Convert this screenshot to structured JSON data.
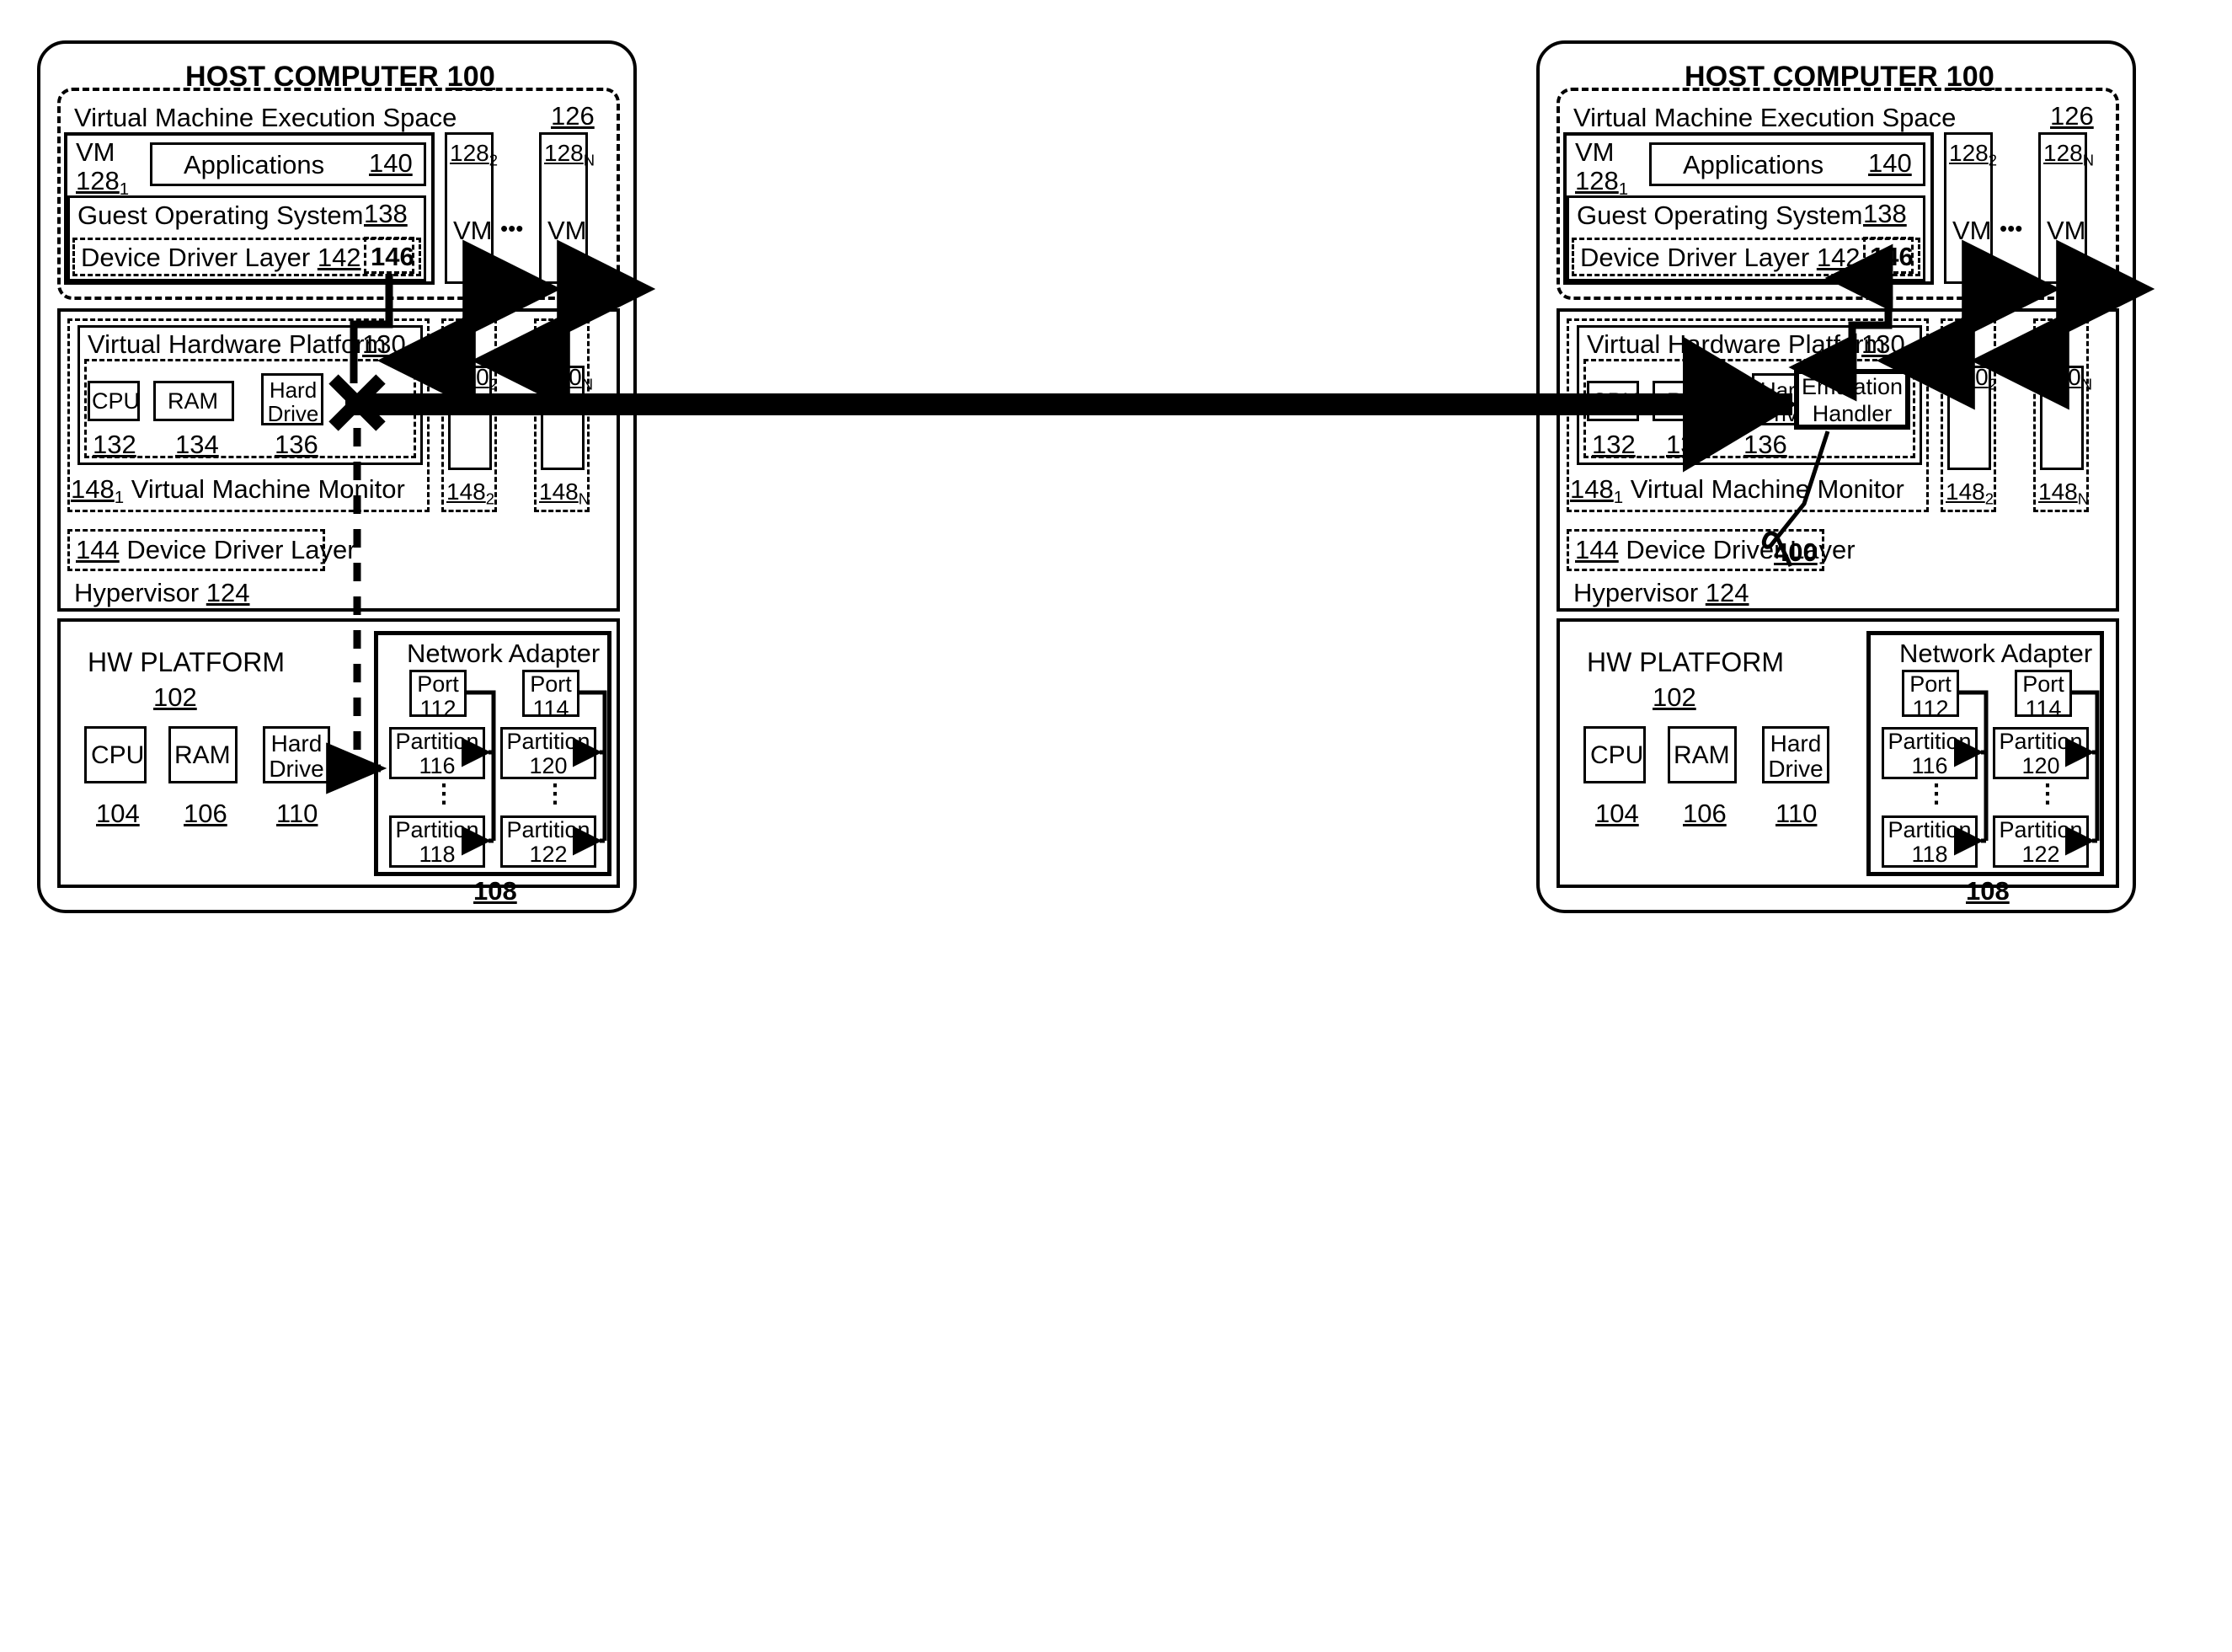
{
  "figure": {
    "panels": [
      {
        "id": "left",
        "host_title": "HOST COMPUTER",
        "host_ref": "100",
        "vmx": {
          "title": "Virtual Machine Execution Space",
          "ref": "126",
          "vm1": {
            "name": "VM",
            "ref_base": "128",
            "ref_sub": "1",
            "applications": "Applications",
            "applications_ref": "140",
            "guest_os": "Guest Operating System",
            "guest_os_ref": "138",
            "ddl": "Device Driver Layer",
            "ddl_ref": "142",
            "box146": "146"
          },
          "vm2": {
            "ref_base": "128",
            "ref_sub": "2",
            "name": "VM"
          },
          "vmn": {
            "ref_base": "128",
            "ref_sub": "N",
            "name": "VM"
          },
          "ellipsis": "•••"
        },
        "hypervisor": {
          "vhp_title": "Virtual Hardware Platform",
          "vhp_ref_base": "130",
          "vhp_ref_sub": "1",
          "cpu": "CPU",
          "cpu_ref": "132",
          "ram": "RAM",
          "ram_ref": "134",
          "hdd": "Hard Drive",
          "hdd_ref": "136",
          "vmm_ref_base": "148",
          "vmm_ref_sub": "1",
          "vmm_title": "Virtual Machine Monitor",
          "vmm2_ref_base": "148",
          "vmm2_ref_sub": "2",
          "vmmn_ref_base": "148",
          "vmmn_ref_sub": "N",
          "vhp2_ref_base": "130",
          "vhp2_ref_sub": "2",
          "vhpn_ref_base": "130",
          "vhpn_ref_sub": "N",
          "ddl144_ref": "144",
          "ddl144_title": "Device Driver Layer",
          "hyp_title": "Hypervisor",
          "hyp_ref": "124",
          "emulation_handler": null,
          "blocked_marker": "X"
        },
        "hw": {
          "title": "HW PLATFORM",
          "ref": "102",
          "cpu": "CPU",
          "cpu_ref": "104",
          "ram": "RAM",
          "ram_ref": "106",
          "hdd": "Hard Drive",
          "hdd_ref": "110",
          "adapter_title": "Network Adapter",
          "adapter_ref": "108",
          "port1": "Port",
          "port1_ref": "112",
          "port2": "Port",
          "port2_ref": "114",
          "part1": "Partition",
          "part1_ref": "116",
          "part2": "Partition",
          "part2_ref": "118",
          "part3": "Partition",
          "part3_ref": "120",
          "part4": "Partition",
          "part4_ref": "122",
          "vdots": "⋮"
        }
      },
      {
        "id": "right",
        "host_title": "HOST COMPUTER",
        "host_ref": "100",
        "vmx": {
          "title": "Virtual Machine Execution Space",
          "ref": "126",
          "vm1": {
            "name": "VM",
            "ref_base": "128",
            "ref_sub": "1",
            "applications": "Applications",
            "applications_ref": "140",
            "guest_os": "Guest Operating System",
            "guest_os_ref": "138",
            "ddl": "Device Driver Layer",
            "ddl_ref": "142",
            "box146": "146"
          },
          "vm2": {
            "ref_base": "128",
            "ref_sub": "2",
            "name": "VM"
          },
          "vmn": {
            "ref_base": "128",
            "ref_sub": "N",
            "name": "VM"
          },
          "ellipsis": "•••"
        },
        "hypervisor": {
          "vhp_title": "Virtual Hardware Platform",
          "vhp_ref_base": "130",
          "vhp_ref_sub": "1",
          "cpu": "CPU",
          "cpu_ref": "132",
          "ram": "RAM",
          "ram_ref": "134",
          "hdd": "Hard Drive",
          "hdd_ref": "136",
          "vmm_ref_base": "148",
          "vmm_ref_sub": "1",
          "vmm_title": "Virtual Machine Monitor",
          "vmm2_ref_base": "148",
          "vmm2_ref_sub": "2",
          "vmmn_ref_base": "148",
          "vmmn_ref_sub": "N",
          "vhp2_ref_base": "130",
          "vhp2_ref_sub": "2",
          "vhpn_ref_base": "130",
          "vhpn_ref_sub": "N",
          "ddl144_ref": "144",
          "ddl144_title": "Device Driver Layer",
          "hyp_title": "Hypervisor",
          "hyp_ref": "124",
          "emulation_handler": "Emulation Handler",
          "emulation_handler_line1": "Emulation",
          "emulation_handler_line2": "Handler",
          "callout_ref": "400",
          "blocked_marker": null
        },
        "hw": {
          "title": "HW PLATFORM",
          "ref": "102",
          "cpu": "CPU",
          "cpu_ref": "104",
          "ram": "RAM",
          "ram_ref": "106",
          "hdd": "Hard Drive",
          "hdd_ref": "110",
          "adapter_title": "Network Adapter",
          "adapter_ref": "108",
          "port1": "Port",
          "port1_ref": "112",
          "port2": "Port",
          "port2_ref": "114",
          "part1": "Partition",
          "part1_ref": "116",
          "part2": "Partition",
          "part2_ref": "118",
          "part3": "Partition",
          "part3_ref": "120",
          "part4": "Partition",
          "part4_ref": "122",
          "vdots": "⋮"
        }
      }
    ],
    "colors": {
      "ink": "#000000",
      "paper": "#ffffff"
    }
  }
}
